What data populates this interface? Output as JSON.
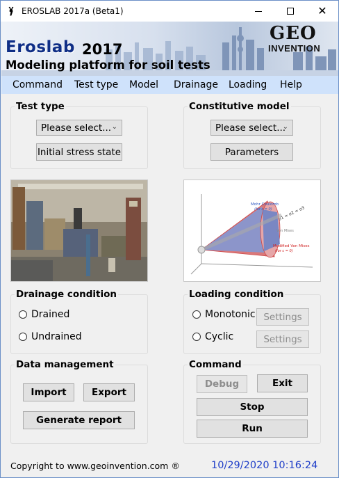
{
  "window": {
    "title": "EROSLAB 2017a (Beta1)",
    "app_icon": "deer-icon",
    "controls": {
      "minimize": "minimize-icon",
      "maximize": "maximize-icon",
      "close": "✕"
    }
  },
  "banner": {
    "brand": "Eroslab",
    "year": "2017",
    "subtitle": "Modeling platform for soil tests",
    "logo_geo": "GEO",
    "logo_invention": "INVENTION"
  },
  "menu": [
    "Command",
    "Test type",
    "Model",
    "Drainage",
    "Loading",
    "Help"
  ],
  "test_type": {
    "title": "Test type",
    "select_value": "Please select...",
    "button": "Initial stress state"
  },
  "constitutive_model": {
    "title": "Constitutive model",
    "select_value": "Please select...",
    "button": "Parameters"
  },
  "diagram": {
    "mohr_coulomb": "Mohr Coulomb",
    "mohr_coulomb_cond": "(for c = 0)",
    "axis_label": "σ1 = σ2 = σ3",
    "von_mises": "Von Mises",
    "modified_von_mises": "Modified Von Mises",
    "modified_cond": "(for c = 0)"
  },
  "drainage": {
    "title": "Drainage condition",
    "options": [
      "Drained",
      "Undrained"
    ]
  },
  "loading": {
    "title": "Loading condition",
    "options": [
      "Monotonic",
      "Cyclic"
    ],
    "settings": "Settings"
  },
  "data_management": {
    "title": "Data management",
    "import": "Import",
    "export": "Export",
    "report": "Generate report"
  },
  "command": {
    "title": "Command",
    "debug": "Debug",
    "exit": "Exit",
    "stop": "Stop",
    "run": "Run"
  },
  "footer": {
    "copyright": "Copyright to www.geoinvention.com ®",
    "datetime": "10/29/2020 10:16:24"
  },
  "colors": {
    "menubar": "#cfe2fb",
    "brand": "#0f2e86",
    "datetime": "#1f3ec8"
  }
}
